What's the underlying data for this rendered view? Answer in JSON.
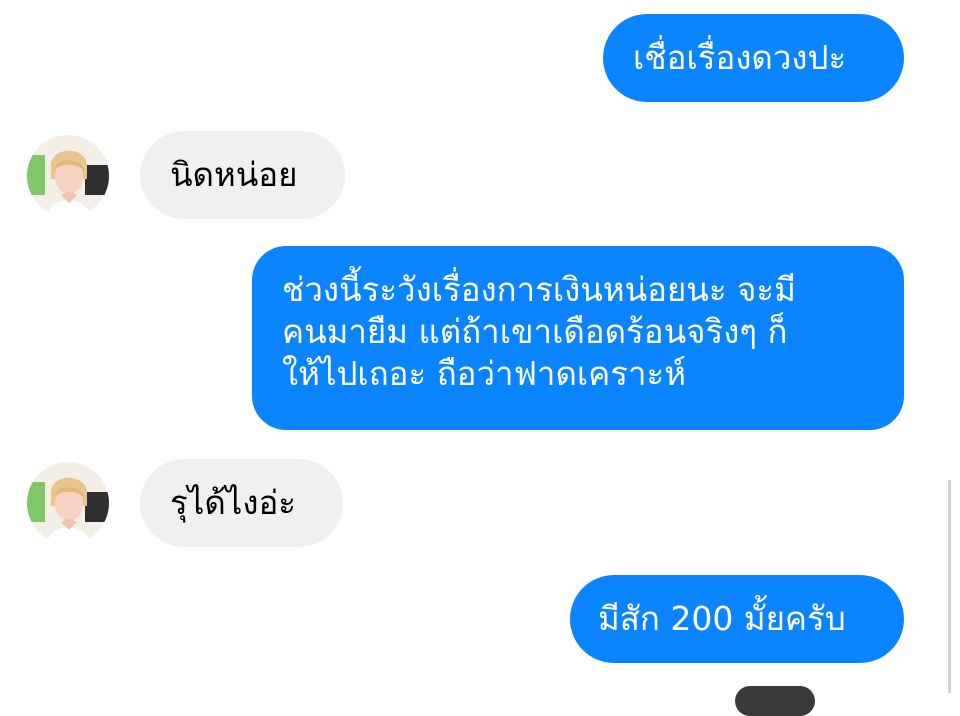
{
  "chat": {
    "messages": [
      {
        "side": "outgoing",
        "text": "เชื่อเรื่องดวงปะ"
      },
      {
        "side": "incoming",
        "text": "นิดหน่อย"
      },
      {
        "side": "outgoing",
        "lines": [
          "ช่วงนี้ระวังเรื่องการเงินหน่อยนะ จะมี",
          "คนมายืม แต่ถ้าเขาเดือดร้อนจริงๆ ก็",
          "ให้ไปเถอะ ถือว่าฟาดเคราะห์"
        ]
      },
      {
        "side": "incoming",
        "text": "รุได้ไงอ่ะ"
      },
      {
        "side": "outgoing",
        "text": "มีสัก 200 มั้ยครับ"
      }
    ]
  },
  "colors": {
    "outgoing_bubble": "#0a84ff",
    "incoming_bubble": "#f0f0f0",
    "background": "#ffffff"
  },
  "icons": {
    "contact_avatar": "avatar-photo"
  }
}
